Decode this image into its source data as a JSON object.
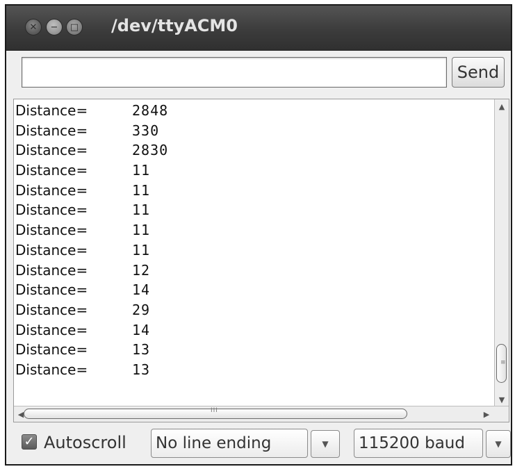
{
  "window": {
    "title": "/dev/ttyACM0",
    "controls": {
      "close_icon": "close-icon",
      "minimize_icon": "minimize-icon",
      "maximize_icon": "maximize-icon"
    }
  },
  "input": {
    "value": "",
    "placeholder": ""
  },
  "send_label": "Send",
  "output": {
    "lines": [
      {
        "label": "Distance=",
        "value": "2848"
      },
      {
        "label": "Distance=",
        "value": "330"
      },
      {
        "label": "Distance=",
        "value": "2830"
      },
      {
        "label": "Distance=",
        "value": "11"
      },
      {
        "label": "Distance=",
        "value": "11"
      },
      {
        "label": "Distance=",
        "value": "11"
      },
      {
        "label": "Distance=",
        "value": "11"
      },
      {
        "label": "Distance=",
        "value": "11"
      },
      {
        "label": "Distance=",
        "value": "12"
      },
      {
        "label": "Distance=",
        "value": "14"
      },
      {
        "label": "Distance=",
        "value": "29"
      },
      {
        "label": "Distance=",
        "value": "14"
      },
      {
        "label": "Distance=",
        "value": "13"
      },
      {
        "label": "Distance=",
        "value": "13"
      }
    ]
  },
  "footer": {
    "autoscroll_label": "Autoscroll",
    "autoscroll_checked": true,
    "line_ending": "No line ending",
    "baud_rate": "115200 baud"
  }
}
